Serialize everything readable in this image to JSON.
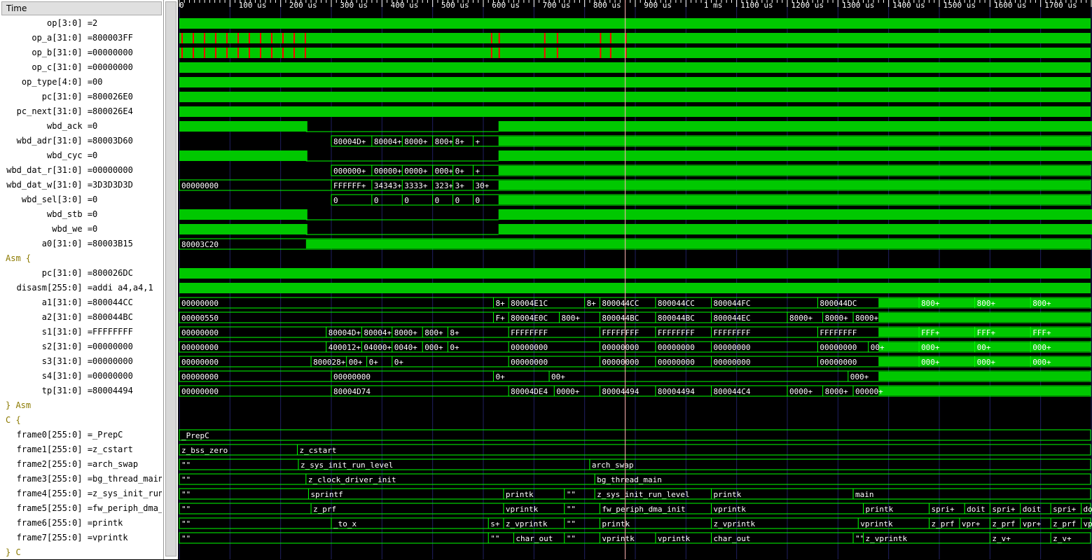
{
  "header": {
    "time_label": "Time"
  },
  "signals": [
    {
      "label": "op[3:0] =2",
      "kind": "bus"
    },
    {
      "label": "op_a[31:0] =800003FF",
      "kind": "bus"
    },
    {
      "label": "op_b[31:0] =00000000",
      "kind": "bus"
    },
    {
      "label": "op_c[31:0] =00000000",
      "kind": "bus"
    },
    {
      "label": "op_type[4:0] =00",
      "kind": "bus"
    },
    {
      "label": "pc[31:0] =800026E0",
      "kind": "bus"
    },
    {
      "label": "pc_next[31:0] =800026E4",
      "kind": "bus"
    },
    {
      "label": "wbd_ack =0",
      "kind": "bit"
    },
    {
      "label": "wbd_adr[31:0] =80003D60",
      "kind": "bus"
    },
    {
      "label": "wbd_cyc =0",
      "kind": "bit"
    },
    {
      "label": "wbd_dat_r[31:0] =00000000",
      "kind": "bus"
    },
    {
      "label": "wbd_dat_w[31:0] =3D3D3D3D",
      "kind": "bus"
    },
    {
      "label": "wbd_sel[3:0] =0",
      "kind": "bus"
    },
    {
      "label": "wbd_stb =0",
      "kind": "bit"
    },
    {
      "label": "wbd_we =0",
      "kind": "bit"
    },
    {
      "label": "a0[31:0] =80003B15",
      "kind": "bus"
    },
    {
      "label": "Asm {",
      "kind": "group"
    },
    {
      "label": "pc[31:0] =800026DC",
      "kind": "bus"
    },
    {
      "label": "disasm[255:0] =addi a4,a4,1",
      "kind": "bus"
    },
    {
      "label": "a1[31:0] =800044CC",
      "kind": "bus"
    },
    {
      "label": "a2[31:0] =800044BC",
      "kind": "bus"
    },
    {
      "label": "s1[31:0] =FFFFFFFF",
      "kind": "bus"
    },
    {
      "label": "s2[31:0] =00000000",
      "kind": "bus"
    },
    {
      "label": "s3[31:0] =00000000",
      "kind": "bus"
    },
    {
      "label": "s4[31:0] =00000000",
      "kind": "bus"
    },
    {
      "label": "tp[31:0] =80004494",
      "kind": "bus"
    },
    {
      "label": "} Asm",
      "kind": "group"
    },
    {
      "label": "C {",
      "kind": "group"
    },
    {
      "label": "frame0[255:0] =_PrepC",
      "kind": "bus"
    },
    {
      "label": "frame1[255:0] =z_cstart",
      "kind": "bus"
    },
    {
      "label": "frame2[255:0] =arch_swap",
      "kind": "bus"
    },
    {
      "label": "frame3[255:0] =bg_thread_main",
      "kind": "bus"
    },
    {
      "label": "frame4[255:0] =z_sys_init_run_level",
      "kind": "bus"
    },
    {
      "label": "frame5[255:0] =fw_periph_dma_init",
      "kind": "bus"
    },
    {
      "label": "frame6[255:0] =printk",
      "kind": "bus"
    },
    {
      "label": "frame7[255:0] =vprintk",
      "kind": "bus"
    },
    {
      "label": "} C",
      "kind": "group"
    }
  ],
  "timeline": {
    "ticks": [
      "0",
      "100 us",
      "200 us",
      "300 us",
      "400 us",
      "500 us",
      "600 us",
      "700 us",
      "800 us",
      "900 us",
      "1 ms",
      "1100 us",
      "1200 us",
      "1300 us",
      "1400 us",
      "1500 us",
      "1600 us",
      "1700 us",
      "18"
    ],
    "cursor_time_us": 880
  },
  "waves": {
    "wbd_adr": [
      [
        300,
        "80004D+"
      ],
      [
        380,
        "80004+"
      ],
      [
        440,
        "8000+"
      ],
      [
        500,
        "800+"
      ],
      [
        540,
        "8+"
      ],
      [
        580,
        "+"
      ]
    ],
    "wbd_dat_r": [
      [
        300,
        "000000+"
      ],
      [
        380,
        "00000+"
      ],
      [
        440,
        "0000+"
      ],
      [
        500,
        "000+"
      ],
      [
        540,
        "0+"
      ],
      [
        580,
        "+"
      ]
    ],
    "wbd_dat_w": [
      [
        0,
        "00000000"
      ],
      [
        300,
        "FFFFFF+"
      ],
      [
        380,
        "34343+"
      ],
      [
        440,
        "3333+"
      ],
      [
        500,
        "323+"
      ],
      [
        540,
        "3+"
      ],
      [
        580,
        "30+"
      ]
    ],
    "wbd_sel": [
      [
        300,
        "0"
      ],
      [
        380,
        "0"
      ],
      [
        440,
        "0"
      ],
      [
        500,
        "0"
      ],
      [
        540,
        "0"
      ],
      [
        580,
        "0"
      ]
    ],
    "a0": [
      [
        0,
        "80003C20"
      ]
    ],
    "a1": [
      [
        0,
        "00000000"
      ],
      [
        620,
        "8+"
      ],
      [
        650,
        "80004E1C"
      ],
      [
        800,
        "8+"
      ],
      [
        830,
        "800044CC"
      ],
      [
        940,
        "800044CC"
      ],
      [
        1050,
        "800044FC"
      ],
      [
        1260,
        "800044DC"
      ],
      [
        1460,
        "800+"
      ],
      [
        1570,
        "800+"
      ],
      [
        1680,
        "800+"
      ]
    ],
    "a2": [
      [
        0,
        "00000550"
      ],
      [
        620,
        "F+"
      ],
      [
        650,
        "80004E0C"
      ],
      [
        750,
        "800+"
      ],
      [
        830,
        "800044BC"
      ],
      [
        940,
        "800044BC"
      ],
      [
        1050,
        "800044EC"
      ],
      [
        1200,
        "8000+"
      ],
      [
        1270,
        "8000+"
      ],
      [
        1330,
        "8000+"
      ]
    ],
    "s1": [
      [
        0,
        "00000000"
      ],
      [
        290,
        "80004D+"
      ],
      [
        360,
        "80004+"
      ],
      [
        420,
        "8000+"
      ],
      [
        480,
        "800+"
      ],
      [
        530,
        "8+"
      ],
      [
        650,
        "FFFFFFFF"
      ],
      [
        830,
        "FFFFFFFF"
      ],
      [
        940,
        "FFFFFFFF"
      ],
      [
        1050,
        "FFFFFFFF"
      ],
      [
        1260,
        "FFFFFFFF"
      ],
      [
        1460,
        "FFF+"
      ],
      [
        1570,
        "FFF+"
      ],
      [
        1680,
        "FFF+"
      ]
    ],
    "s2": [
      [
        0,
        "00000000"
      ],
      [
        290,
        "400012+"
      ],
      [
        360,
        "04000+"
      ],
      [
        420,
        "0040+"
      ],
      [
        480,
        "000+"
      ],
      [
        530,
        "0+"
      ],
      [
        650,
        "00000000"
      ],
      [
        830,
        "00000000"
      ],
      [
        940,
        "00000000"
      ],
      [
        1050,
        "00000000"
      ],
      [
        1260,
        "00000000"
      ],
      [
        1360,
        "00+"
      ],
      [
        1460,
        "000+"
      ],
      [
        1570,
        "00+"
      ],
      [
        1680,
        "000+"
      ]
    ],
    "s3": [
      [
        0,
        "00000000"
      ],
      [
        260,
        "800028+"
      ],
      [
        330,
        "00+"
      ],
      [
        370,
        "0+"
      ],
      [
        420,
        "0+"
      ],
      [
        650,
        "00000000"
      ],
      [
        830,
        "00000000"
      ],
      [
        940,
        "00000000"
      ],
      [
        1050,
        "00000000"
      ],
      [
        1260,
        "00000000"
      ],
      [
        1460,
        "000+"
      ],
      [
        1570,
        "000+"
      ],
      [
        1680,
        "000+"
      ]
    ],
    "s4": [
      [
        0,
        "00000000"
      ],
      [
        300,
        "00000000"
      ],
      [
        620,
        "0+"
      ],
      [
        730,
        "00+"
      ],
      [
        1320,
        "000+"
      ]
    ],
    "tp": [
      [
        0,
        "00000000"
      ],
      [
        300,
        "80004D74"
      ],
      [
        650,
        "80004DE4"
      ],
      [
        740,
        "0000+"
      ],
      [
        830,
        "80004494"
      ],
      [
        940,
        "80004494"
      ],
      [
        1050,
        "800044C4"
      ],
      [
        1200,
        "0000+"
      ],
      [
        1270,
        "8000+"
      ],
      [
        1330,
        "00000+"
      ]
    ],
    "frame0": [
      [
        0,
        "_PrepC"
      ]
    ],
    "frame1": [
      [
        0,
        "z_bss_zero"
      ],
      [
        233,
        "z_cstart"
      ]
    ],
    "frame2": [
      [
        0,
        "\"\""
      ],
      [
        235,
        "z_sys_init_run_level"
      ],
      [
        810,
        "arch_swap"
      ]
    ],
    "frame3": [
      [
        0,
        "\"\""
      ],
      [
        250,
        "z_clock_driver_init"
      ],
      [
        820,
        "bg_thread_main"
      ]
    ],
    "frame4": [
      [
        0,
        "\"\""
      ],
      [
        255,
        "sprintf"
      ],
      [
        640,
        "printk"
      ],
      [
        760,
        "\"\""
      ],
      [
        820,
        "z_sys_init_run_level"
      ],
      [
        1050,
        "printk"
      ],
      [
        1330,
        "main"
      ]
    ],
    "frame5": [
      [
        0,
        "\"\""
      ],
      [
        260,
        "z_prf"
      ],
      [
        640,
        "vprintk"
      ],
      [
        760,
        "\"\""
      ],
      [
        830,
        "fw_periph_dma_init"
      ],
      [
        1050,
        "vprintk"
      ],
      [
        1350,
        "printk"
      ],
      [
        1480,
        "spri+"
      ],
      [
        1550,
        "doit"
      ],
      [
        1600,
        "spri+"
      ],
      [
        1660,
        "doit"
      ],
      [
        1720,
        "spri+"
      ],
      [
        1780,
        "doit"
      ]
    ],
    "frame6": [
      [
        0,
        "\"\""
      ],
      [
        300,
        "_to_x"
      ],
      [
        610,
        "s+"
      ],
      [
        640,
        "z_vprintk"
      ],
      [
        760,
        "\"\""
      ],
      [
        830,
        "printk"
      ],
      [
        1050,
        "z_vprintk"
      ],
      [
        1340,
        "vprintk"
      ],
      [
        1480,
        "z_prf"
      ],
      [
        1540,
        "vpr+"
      ],
      [
        1600,
        "z_prf"
      ],
      [
        1660,
        "vpr+"
      ],
      [
        1720,
        "z_prf"
      ],
      [
        1780,
        "vpr+"
      ]
    ],
    "frame7": [
      [
        0,
        "\"\""
      ],
      [
        610,
        "\"\""
      ],
      [
        660,
        "char_out"
      ],
      [
        760,
        "\"\""
      ],
      [
        830,
        "vprintk"
      ],
      [
        940,
        "vprintk"
      ],
      [
        1050,
        "char_out"
      ],
      [
        1330,
        "\"\""
      ],
      [
        1350,
        "z_vprintk"
      ],
      [
        1600,
        "z_v+"
      ],
      [
        1720,
        "z_v+"
      ]
    ]
  },
  "colors": {
    "wave": "#00c800",
    "wave_line": "#00ff00",
    "glitch": "#ff0000",
    "text": "#ffffff",
    "grid": "#202060",
    "cursor": "#ffb0b0",
    "group": "#8c7a00"
  }
}
